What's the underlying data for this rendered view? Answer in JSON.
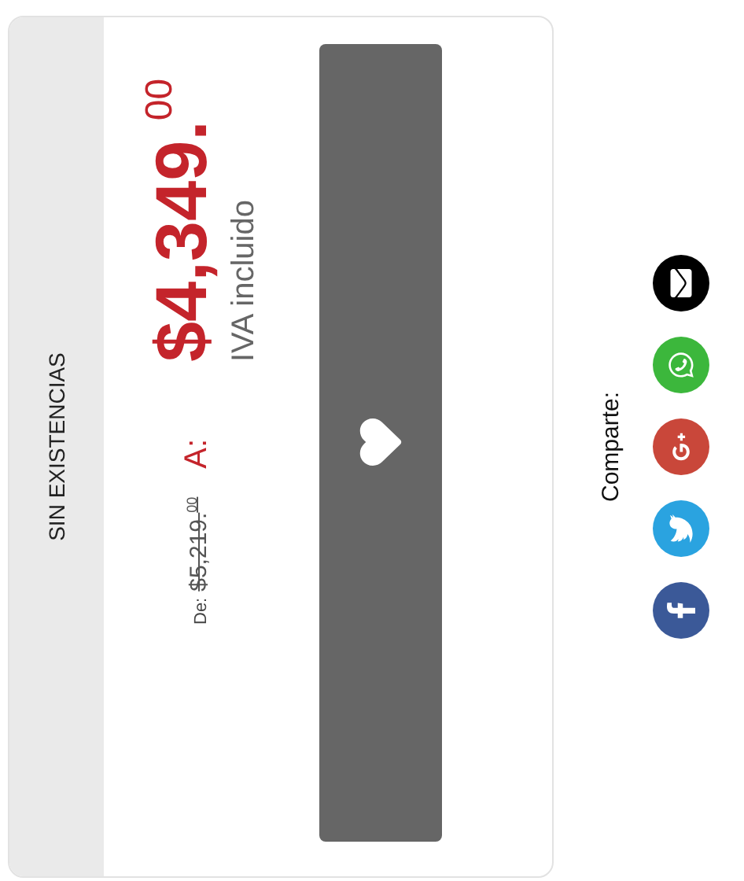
{
  "product_card": {
    "stock_status": "SIN EXISTENCIAS",
    "old_price_label": "De:",
    "old_price": "$5,219.$^{00}$",
    "price_label": "A:",
    "price": "$4,349.$^{00}$",
    "tax_note": "IVA incluido",
    "action_button": {
      "kind": "favorite"
    }
  },
  "share": {
    "label": "Comparte:",
    "networks": [
      {
        "kind": "facebook"
      },
      {
        "kind": "twitter"
      },
      {
        "kind": "google_plus"
      },
      {
        "kind": "whatsapp"
      },
      {
        "kind": "email"
      }
    ]
  }
}
